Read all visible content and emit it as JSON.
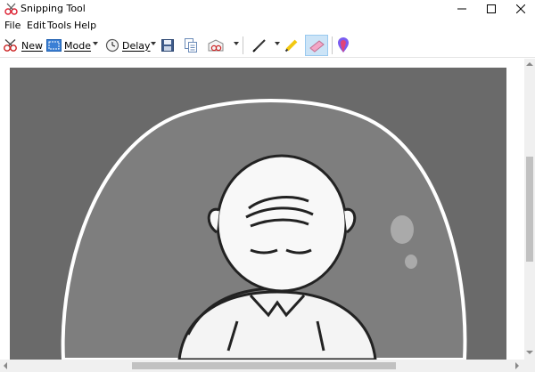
{
  "window": {
    "title": "Snipping Tool",
    "icon": "scissors-icon",
    "controls": [
      "minimize-icon",
      "maximize-icon",
      "close-icon"
    ]
  },
  "menu": {
    "file": "File",
    "edit": "Edit",
    "tools": "Tools",
    "help": "Help"
  },
  "toolbar": {
    "new_label": "New",
    "mode_label": "Mode",
    "delay_label": "Delay",
    "new_icon": "snip-new-icon",
    "mode_icon": "mode-icon",
    "delay_icon": "clock-icon",
    "save_icon": "save-icon",
    "copy_icon": "copy-icon",
    "send_icon": "send-snip-icon",
    "pen_icon": "pen-icon",
    "highlighter_icon": "highlighter-icon",
    "eraser_icon": "eraser-icon",
    "paint3d_icon": "paint3d-icon",
    "selected_tool": "eraser",
    "accent_selected": "#cce4f7"
  },
  "capture": {
    "description_type": "cartoon-image",
    "background_color": "#6a6a6a"
  },
  "scrollbars": {
    "vertical_position": 0.33,
    "horizontal_position": 0.25
  }
}
